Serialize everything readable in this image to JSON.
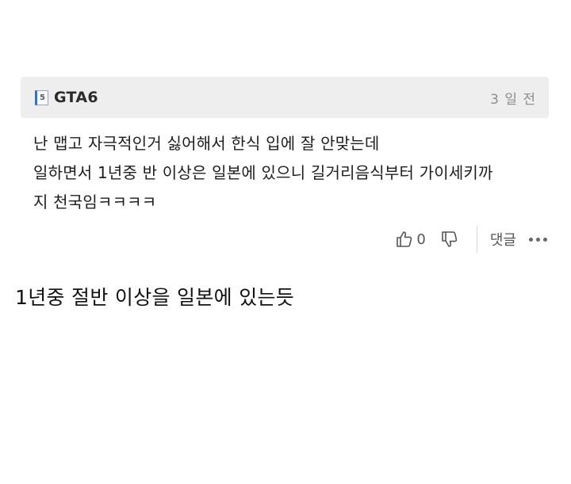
{
  "comment": {
    "level_badge": "5",
    "nickname": "GTA6",
    "timestamp": "3 일 전",
    "lines": [
      "난 맵고 자극적인거 싫어해서 한식 입에 잘 안맞는데",
      "일하면서 1년중 반 이상은 일본에 있으니 길거리음식부터 가이세키까",
      "지 천국임ㅋㅋㅋㅋ"
    ],
    "like_count": "0",
    "reply_label": "댓글",
    "icons": [
      "thumbs-up-icon",
      "thumbs-down-icon",
      "more-icon"
    ]
  },
  "caption": "1년중 절반 이상을 일본에 있는듯",
  "colors": {
    "header_bg": "#eeeeee",
    "badge_accent": "#3f6fb5",
    "timestamp": "#8c8c8c"
  }
}
